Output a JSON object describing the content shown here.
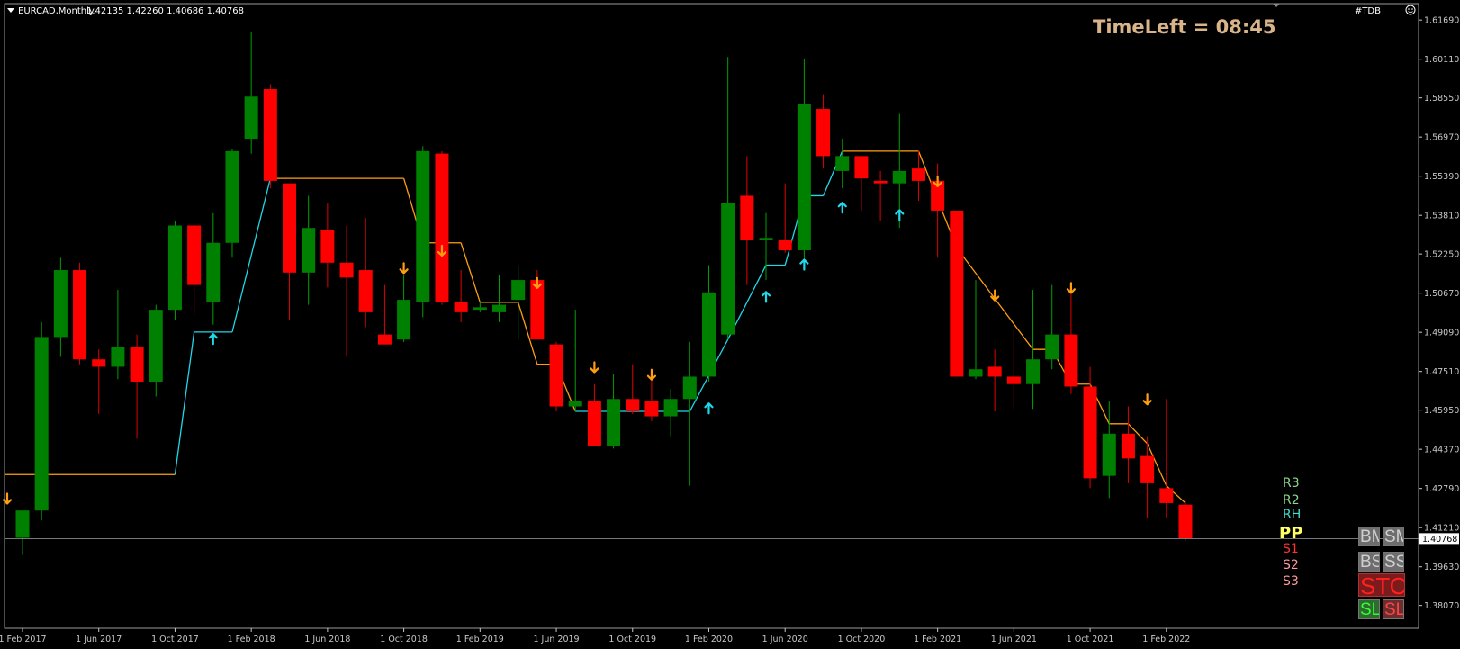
{
  "header": {
    "symbol": "EURCAD,Monthly",
    "ohlc": "1.42135 1.42260 1.40686 1.40768",
    "tag": "#TDB",
    "timeleft": "TimeLeft = 08:45"
  },
  "colors": {
    "background": "#000000",
    "bull": "#008000",
    "bear": "#ff0000",
    "wick_bull": "#00a000",
    "wick_bear": "#e00000",
    "trail_up": "#20d8e8",
    "trail_down": "#ff9f10",
    "axis": "#c8c8c8",
    "timeleft": "#d9b48a"
  },
  "pivot_labels": [
    {
      "text": "R3",
      "color": "#8ad88a"
    },
    {
      "text": "R2",
      "color": "#8ad88a"
    },
    {
      "text": "RH",
      "color": "#40e0d0"
    },
    {
      "text": "PP",
      "color": "#ffff66"
    },
    {
      "text": "S1",
      "color": "#ff3030"
    },
    {
      "text": "S2",
      "color": "#ff9a9a"
    },
    {
      "text": "S3",
      "color": "#ff9a9a"
    }
  ],
  "buttons": {
    "row1": [
      "BM",
      "SM"
    ],
    "row2": [
      "BS",
      "SS"
    ],
    "stop": "STOP",
    "row4": [
      "SL/TP",
      "SL/TP"
    ]
  },
  "chart_data": {
    "type": "candlestick",
    "ylim": [
      1.3715,
      1.6235
    ],
    "y_ticks": [
      "1.61690",
      "1.60110",
      "1.58550",
      "1.56970",
      "1.55390",
      "1.53810",
      "1.52250",
      "1.50670",
      "1.49090",
      "1.47510",
      "1.45950",
      "1.44370",
      "1.42790",
      "1.41210",
      "1.39630",
      "1.38070"
    ],
    "current_price": "1.40768",
    "x_ticks": [
      "1 Feb 2017",
      "1 Jun 2017",
      "1 Oct 2017",
      "1 Feb 2018",
      "1 Jun 2018",
      "1 Oct 2018",
      "1 Feb 2019",
      "1 Jun 2019",
      "1 Oct 2019",
      "1 Feb 2020",
      "1 Jun 2020",
      "1 Oct 2020",
      "1 Feb 2021",
      "1 Jun 2021",
      "1 Oct 2021",
      "1 Feb 2022"
    ],
    "candles": [
      {
        "date": "2017-02",
        "o": 1.408,
        "h": 1.419,
        "l": 1.401,
        "c": 1.419
      },
      {
        "date": "2017-03",
        "o": 1.419,
        "h": 1.495,
        "l": 1.415,
        "c": 1.489
      },
      {
        "date": "2017-04",
        "o": 1.489,
        "h": 1.521,
        "l": 1.481,
        "c": 1.516
      },
      {
        "date": "2017-05",
        "o": 1.516,
        "h": 1.519,
        "l": 1.478,
        "c": 1.48
      },
      {
        "date": "2017-06",
        "o": 1.48,
        "h": 1.484,
        "l": 1.458,
        "c": 1.477
      },
      {
        "date": "2017-07",
        "o": 1.477,
        "h": 1.508,
        "l": 1.472,
        "c": 1.485
      },
      {
        "date": "2017-08",
        "o": 1.485,
        "h": 1.49,
        "l": 1.448,
        "c": 1.471
      },
      {
        "date": "2017-09",
        "o": 1.471,
        "h": 1.502,
        "l": 1.465,
        "c": 1.5
      },
      {
        "date": "2017-10",
        "o": 1.5,
        "h": 1.536,
        "l": 1.496,
        "c": 1.534
      },
      {
        "date": "2017-11",
        "o": 1.534,
        "h": 1.535,
        "l": 1.498,
        "c": 1.51
      },
      {
        "date": "2017-12",
        "o": 1.503,
        "h": 1.539,
        "l": 1.494,
        "c": 1.527
      },
      {
        "date": "2018-01",
        "o": 1.527,
        "h": 1.565,
        "l": 1.521,
        "c": 1.564
      },
      {
        "date": "2018-02",
        "o": 1.569,
        "h": 1.612,
        "l": 1.563,
        "c": 1.586
      },
      {
        "date": "2018-03",
        "o": 1.589,
        "h": 1.591,
        "l": 1.549,
        "c": 1.552
      },
      {
        "date": "2018-04",
        "o": 1.551,
        "h": 1.551,
        "l": 1.496,
        "c": 1.515
      },
      {
        "date": "2018-05",
        "o": 1.515,
        "h": 1.546,
        "l": 1.502,
        "c": 1.533
      },
      {
        "date": "2018-06",
        "o": 1.532,
        "h": 1.543,
        "l": 1.509,
        "c": 1.519
      },
      {
        "date": "2018-07",
        "o": 1.519,
        "h": 1.534,
        "l": 1.481,
        "c": 1.513
      },
      {
        "date": "2018-08",
        "o": 1.516,
        "h": 1.537,
        "l": 1.493,
        "c": 1.499
      },
      {
        "date": "2018-09",
        "o": 1.49,
        "h": 1.51,
        "l": 1.486,
        "c": 1.486
      },
      {
        "date": "2018-10",
        "o": 1.488,
        "h": 1.514,
        "l": 1.487,
        "c": 1.504
      },
      {
        "date": "2018-11",
        "o": 1.503,
        "h": 1.566,
        "l": 1.497,
        "c": 1.564
      },
      {
        "date": "2018-12",
        "o": 1.563,
        "h": 1.564,
        "l": 1.502,
        "c": 1.503
      },
      {
        "date": "2019-01",
        "o": 1.503,
        "h": 1.516,
        "l": 1.495,
        "c": 1.499
      },
      {
        "date": "2019-02",
        "o": 1.5,
        "h": 1.503,
        "l": 1.499,
        "c": 1.501
      },
      {
        "date": "2019-03",
        "o": 1.499,
        "h": 1.514,
        "l": 1.495,
        "c": 1.502
      },
      {
        "date": "2019-04",
        "o": 1.504,
        "h": 1.518,
        "l": 1.488,
        "c": 1.512
      },
      {
        "date": "2019-05",
        "o": 1.512,
        "h": 1.516,
        "l": 1.488,
        "c": 1.488
      },
      {
        "date": "2019-06",
        "o": 1.486,
        "h": 1.487,
        "l": 1.459,
        "c": 1.461
      },
      {
        "date": "2019-07",
        "o": 1.461,
        "h": 1.5,
        "l": 1.459,
        "c": 1.463
      },
      {
        "date": "2019-08",
        "o": 1.463,
        "h": 1.47,
        "l": 1.445,
        "c": 1.445
      },
      {
        "date": "2019-09",
        "o": 1.445,
        "h": 1.474,
        "l": 1.444,
        "c": 1.464
      },
      {
        "date": "2019-10",
        "o": 1.464,
        "h": 1.478,
        "l": 1.458,
        "c": 1.459
      },
      {
        "date": "2019-11",
        "o": 1.463,
        "h": 1.475,
        "l": 1.455,
        "c": 1.457
      },
      {
        "date": "2019-12",
        "o": 1.457,
        "h": 1.468,
        "l": 1.449,
        "c": 1.464
      },
      {
        "date": "2020-01",
        "o": 1.464,
        "h": 1.487,
        "l": 1.429,
        "c": 1.473
      },
      {
        "date": "2020-02",
        "o": 1.473,
        "h": 1.518,
        "l": 1.471,
        "c": 1.507
      },
      {
        "date": "2020-03",
        "o": 1.49,
        "h": 1.602,
        "l": 1.488,
        "c": 1.543
      },
      {
        "date": "2020-04",
        "o": 1.546,
        "h": 1.562,
        "l": 1.51,
        "c": 1.528
      },
      {
        "date": "2020-05",
        "o": 1.528,
        "h": 1.539,
        "l": 1.512,
        "c": 1.529
      },
      {
        "date": "2020-06",
        "o": 1.528,
        "h": 1.551,
        "l": 1.523,
        "c": 1.524
      },
      {
        "date": "2020-07",
        "o": 1.524,
        "h": 1.601,
        "l": 1.518,
        "c": 1.583
      },
      {
        "date": "2020-08",
        "o": 1.581,
        "h": 1.587,
        "l": 1.557,
        "c": 1.562
      },
      {
        "date": "2020-09",
        "o": 1.556,
        "h": 1.569,
        "l": 1.549,
        "c": 1.562
      },
      {
        "date": "2020-10",
        "o": 1.562,
        "h": 1.562,
        "l": 1.54,
        "c": 1.553
      },
      {
        "date": "2020-11",
        "o": 1.552,
        "h": 1.556,
        "l": 1.536,
        "c": 1.551
      },
      {
        "date": "2020-12",
        "o": 1.551,
        "h": 1.579,
        "l": 1.533,
        "c": 1.556
      },
      {
        "date": "2021-01",
        "o": 1.557,
        "h": 1.564,
        "l": 1.544,
        "c": 1.552
      },
      {
        "date": "2021-02",
        "o": 1.552,
        "h": 1.559,
        "l": 1.521,
        "c": 1.54
      },
      {
        "date": "2021-03",
        "o": 1.54,
        "h": 1.54,
        "l": 1.473,
        "c": 1.473
      },
      {
        "date": "2021-04",
        "o": 1.473,
        "h": 1.512,
        "l": 1.472,
        "c": 1.476
      },
      {
        "date": "2021-05",
        "o": 1.477,
        "h": 1.484,
        "l": 1.459,
        "c": 1.473
      },
      {
        "date": "2021-06",
        "o": 1.473,
        "h": 1.492,
        "l": 1.46,
        "c": 1.47
      },
      {
        "date": "2021-07",
        "o": 1.47,
        "h": 1.508,
        "l": 1.46,
        "c": 1.48
      },
      {
        "date": "2021-08",
        "o": 1.48,
        "h": 1.51,
        "l": 1.476,
        "c": 1.49
      },
      {
        "date": "2021-09",
        "o": 1.49,
        "h": 1.509,
        "l": 1.466,
        "c": 1.469
      },
      {
        "date": "2021-10",
        "o": 1.469,
        "h": 1.477,
        "l": 1.428,
        "c": 1.432
      },
      {
        "date": "2021-11",
        "o": 1.433,
        "h": 1.463,
        "l": 1.424,
        "c": 1.45
      },
      {
        "date": "2021-12",
        "o": 1.45,
        "h": 1.461,
        "l": 1.43,
        "c": 1.44
      },
      {
        "date": "2022-01",
        "o": 1.441,
        "h": 1.449,
        "l": 1.416,
        "c": 1.43
      },
      {
        "date": "2022-02",
        "o": 1.428,
        "h": 1.464,
        "l": 1.416,
        "c": 1.422
      },
      {
        "date": "2022-03",
        "o": 1.42135,
        "h": 1.4226,
        "l": 1.40686,
        "c": 1.40768
      }
    ],
    "trail_line": [
      {
        "date": "2017-02",
        "y": 1.4335,
        "dir": "down"
      },
      {
        "date": "2017-10",
        "y": 1.4335,
        "dir": "down"
      },
      {
        "date": "2017-11",
        "y": 1.491,
        "dir": "up"
      },
      {
        "date": "2018-01",
        "y": 1.491,
        "dir": "up"
      },
      {
        "date": "2018-03",
        "y": 1.553,
        "dir": "up"
      },
      {
        "date": "2018-10",
        "y": 1.553,
        "dir": "down"
      },
      {
        "date": "2018-11",
        "y": 1.527,
        "dir": "down"
      },
      {
        "date": "2019-01",
        "y": 1.527,
        "dir": "down"
      },
      {
        "date": "2019-02",
        "y": 1.503,
        "dir": "down"
      },
      {
        "date": "2019-04",
        "y": 1.503,
        "dir": "down"
      },
      {
        "date": "2019-05",
        "y": 1.478,
        "dir": "down"
      },
      {
        "date": "2019-06",
        "y": 1.478,
        "dir": "down"
      },
      {
        "date": "2019-07",
        "y": 1.459,
        "dir": "down"
      },
      {
        "date": "2020-01",
        "y": 1.459,
        "dir": "up"
      },
      {
        "date": "2020-03",
        "y": 1.488,
        "dir": "up"
      },
      {
        "date": "2020-05",
        "y": 1.518,
        "dir": "up"
      },
      {
        "date": "2020-06",
        "y": 1.518,
        "dir": "up"
      },
      {
        "date": "2020-07",
        "y": 1.546,
        "dir": "up"
      },
      {
        "date": "2020-08",
        "y": 1.546,
        "dir": "up"
      },
      {
        "date": "2020-09",
        "y": 1.564,
        "dir": "up"
      },
      {
        "date": "2021-01",
        "y": 1.564,
        "dir": "down"
      },
      {
        "date": "2021-03",
        "y": 1.525,
        "dir": "down"
      },
      {
        "date": "2021-07",
        "y": 1.484,
        "dir": "down"
      },
      {
        "date": "2021-08",
        "y": 1.484,
        "dir": "down"
      },
      {
        "date": "2021-09",
        "y": 1.47,
        "dir": "down"
      },
      {
        "date": "2021-10",
        "y": 1.47,
        "dir": "down"
      },
      {
        "date": "2021-11",
        "y": 1.454,
        "dir": "down"
      },
      {
        "date": "2021-12",
        "y": 1.454,
        "dir": "down"
      },
      {
        "date": "2022-01",
        "y": 1.446,
        "dir": "down"
      },
      {
        "date": "2022-02",
        "y": 1.429,
        "dir": "down"
      },
      {
        "date": "2022-03",
        "y": 1.422,
        "dir": "down"
      }
    ],
    "arrows": [
      {
        "date": "2017-12",
        "y": 1.488,
        "dir": "up"
      },
      {
        "date": "2018-12",
        "y": 1.524,
        "dir": "down"
      },
      {
        "date": "2018-10",
        "y": 1.517,
        "dir": "down"
      },
      {
        "date": "2019-05",
        "y": 1.511,
        "dir": "down"
      },
      {
        "date": "2019-08",
        "y": 1.477,
        "dir": "down"
      },
      {
        "date": "2019-11",
        "y": 1.474,
        "dir": "down"
      },
      {
        "date": "2020-02",
        "y": 1.46,
        "dir": "up"
      },
      {
        "date": "2020-05",
        "y": 1.505,
        "dir": "up"
      },
      {
        "date": "2020-07",
        "y": 1.518,
        "dir": "up"
      },
      {
        "date": "2020-09",
        "y": 1.541,
        "dir": "up"
      },
      {
        "date": "2020-12",
        "y": 1.538,
        "dir": "up"
      },
      {
        "date": "2021-02",
        "y": 1.552,
        "dir": "down"
      },
      {
        "date": "2021-05",
        "y": 1.506,
        "dir": "down"
      },
      {
        "date": "2021-09",
        "y": 1.509,
        "dir": "down"
      },
      {
        "date": "2022-01",
        "y": 1.464,
        "dir": "down"
      },
      {
        "date": "2017-01",
        "y": 1.424,
        "dir": "down"
      }
    ]
  }
}
